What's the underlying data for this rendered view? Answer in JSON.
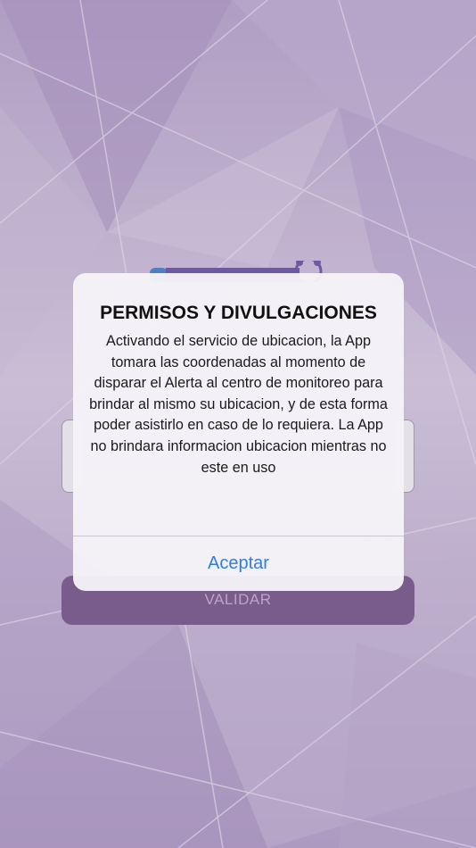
{
  "alert": {
    "title": "PERMISOS Y DIVULGACIONES",
    "message": "Activando el servicio de ubicacion, la App tomara las coordenadas al momento de disparar el Alerta al centro de monitoreo para brindar al mismo su ubicacion, y de esta forma poder asistirlo en caso de lo requiera. La App no brindara informacion ubicacion mientras no este en uso",
    "accept_label": "Aceptar"
  },
  "app": {
    "validate_label": "VALIDAR"
  },
  "colors": {
    "accent": "#2f7ee0",
    "button_bg": "#7a5c8c",
    "background": "#b9a9c8"
  }
}
